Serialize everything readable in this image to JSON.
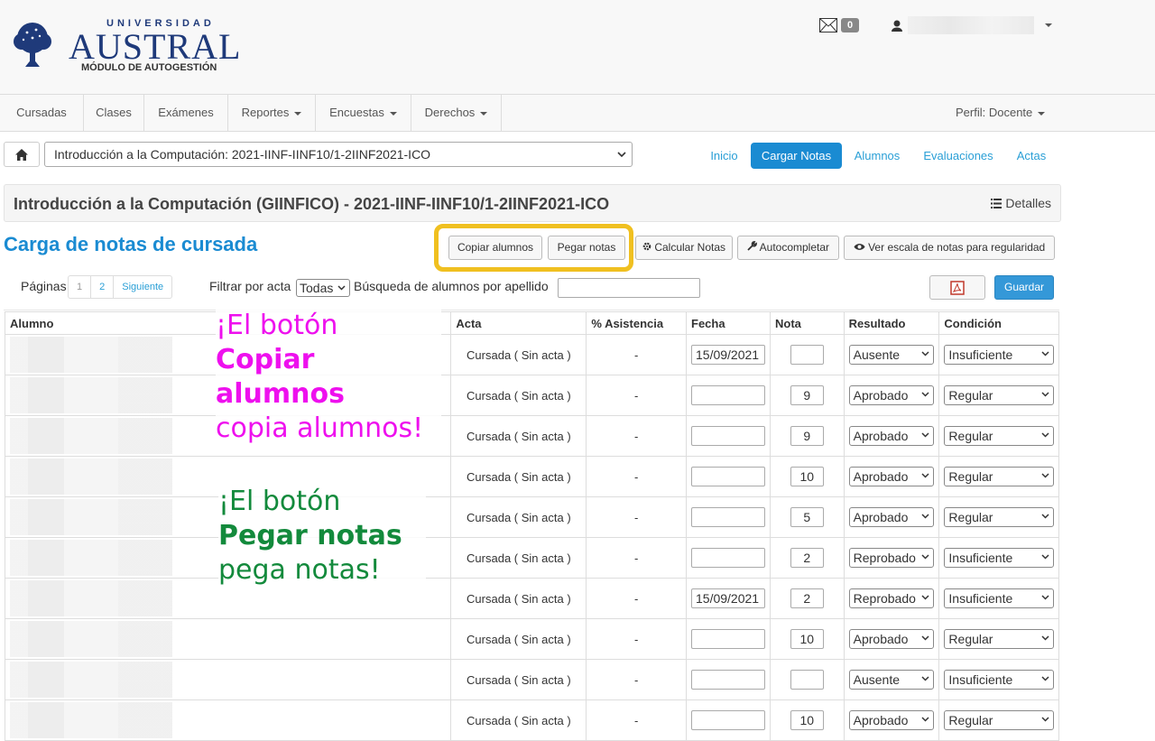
{
  "header": {
    "logo": {
      "university": "UNIVERSIDAD",
      "name": "AUSTRAL",
      "subtitle": "MÓDULO DE AUTOGESTIÓN"
    },
    "mail_count": "0"
  },
  "nav": {
    "items": [
      "Cursadas",
      "Clases",
      "Exámenes",
      "Reportes",
      "Encuestas",
      "Derechos"
    ],
    "perfil": "Perfil: Docente"
  },
  "course_select": "Introducción a la Computación: 2021-IINF-IINF10/1-2IINF2021-ICO",
  "tabs": [
    "Inicio",
    "Cargar Notas",
    "Alumnos",
    "Evaluaciones",
    "Actas"
  ],
  "title": "Introducción a la Computación (GIINFICO) - 2021-IINF-IINF10/1-2IINF2021-ICO",
  "detalles": "Detalles",
  "page_heading": "Carga de notas de cursada",
  "buttons": {
    "copiar": "Copiar alumnos",
    "pegar": "Pegar notas",
    "calcular": "Calcular Notas",
    "autocompletar": "Autocompletar",
    "escala": "Ver escala de notas para regularidad",
    "guardar": "Guardar"
  },
  "filters": {
    "paginas_label": "Páginas",
    "pages": [
      "1",
      "2",
      "Siguiente"
    ],
    "filtrar_label": "Filtrar por acta",
    "filtrar_value": "Todas",
    "busqueda_label": "Búsqueda de alumnos por apellido",
    "busqueda_value": ""
  },
  "table": {
    "headers": [
      "Alumno",
      "Acta",
      "% Asistencia",
      "Fecha",
      "Nota",
      "Resultado",
      "Condición"
    ],
    "rows": [
      {
        "acta": "Cursada ( Sin acta )",
        "asistencia": "-",
        "fecha": "15/09/2021",
        "nota": "",
        "resultado": "Ausente",
        "condicion": "Insuficiente"
      },
      {
        "acta": "Cursada ( Sin acta )",
        "asistencia": "-",
        "fecha": "",
        "nota": "9",
        "resultado": "Aprobado",
        "condicion": "Regular"
      },
      {
        "acta": "Cursada ( Sin acta )",
        "asistencia": "-",
        "fecha": "",
        "nota": "9",
        "resultado": "Aprobado",
        "condicion": "Regular"
      },
      {
        "acta": "Cursada ( Sin acta )",
        "asistencia": "-",
        "fecha": "",
        "nota": "10",
        "resultado": "Aprobado",
        "condicion": "Regular"
      },
      {
        "acta": "Cursada ( Sin acta )",
        "asistencia": "-",
        "fecha": "",
        "nota": "5",
        "resultado": "Aprobado",
        "condicion": "Regular"
      },
      {
        "acta": "Cursada ( Sin acta )",
        "asistencia": "-",
        "fecha": "",
        "nota": "2",
        "resultado": "Reprobado",
        "condicion": "Insuficiente"
      },
      {
        "acta": "Cursada ( Sin acta )",
        "asistencia": "-",
        "fecha": "15/09/2021",
        "nota": "2",
        "resultado": "Reprobado",
        "condicion": "Insuficiente"
      },
      {
        "acta": "Cursada ( Sin acta )",
        "asistencia": "-",
        "fecha": "",
        "nota": "10",
        "resultado": "Aprobado",
        "condicion": "Regular"
      },
      {
        "acta": "Cursada ( Sin acta )",
        "asistencia": "-",
        "fecha": "",
        "nota": "",
        "resultado": "Ausente",
        "condicion": "Insuficiente"
      },
      {
        "acta": "Cursada ( Sin acta )",
        "asistencia": "-",
        "fecha": "",
        "nota": "10",
        "resultado": "Aprobado",
        "condicion": "Regular"
      }
    ]
  },
  "annotations": {
    "copiar": {
      "line1": "¡El botón",
      "bold1": "Copiar",
      "bold2": "alumnos",
      "line4": "copia alumnos!"
    },
    "pegar": {
      "line1": "¡El botón",
      "bold1": "Pegar notas",
      "line3": "pega notas!"
    }
  },
  "colors": {
    "primary": "#1a8bd2",
    "highlight": "#f0c020",
    "annotation_magenta": "#ee10ee",
    "annotation_green": "#138a3c"
  }
}
